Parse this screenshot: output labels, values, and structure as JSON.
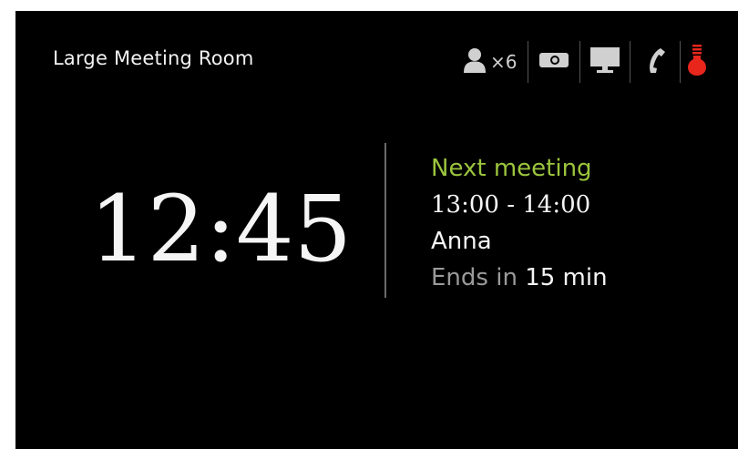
{
  "room": {
    "name": "Large Meeting Room"
  },
  "amenities": {
    "capacity_icon": "person-icon",
    "capacity_count": "×6",
    "items": [
      {
        "icon": "projector-icon"
      },
      {
        "icon": "display-icon"
      },
      {
        "icon": "phone-icon"
      },
      {
        "icon": "status-lightbulb-icon"
      }
    ],
    "status_color": "#e8261c"
  },
  "clock": {
    "time": "12:45"
  },
  "next_meeting": {
    "label": "Next meeting",
    "time_range": "13:00 - 14:00",
    "organizer": "Anna",
    "ends_prefix": "Ends in",
    "ends_value": "15 min"
  },
  "colors": {
    "background": "#000000",
    "accent": "#9bc53d",
    "muted": "#9a9a9a"
  }
}
